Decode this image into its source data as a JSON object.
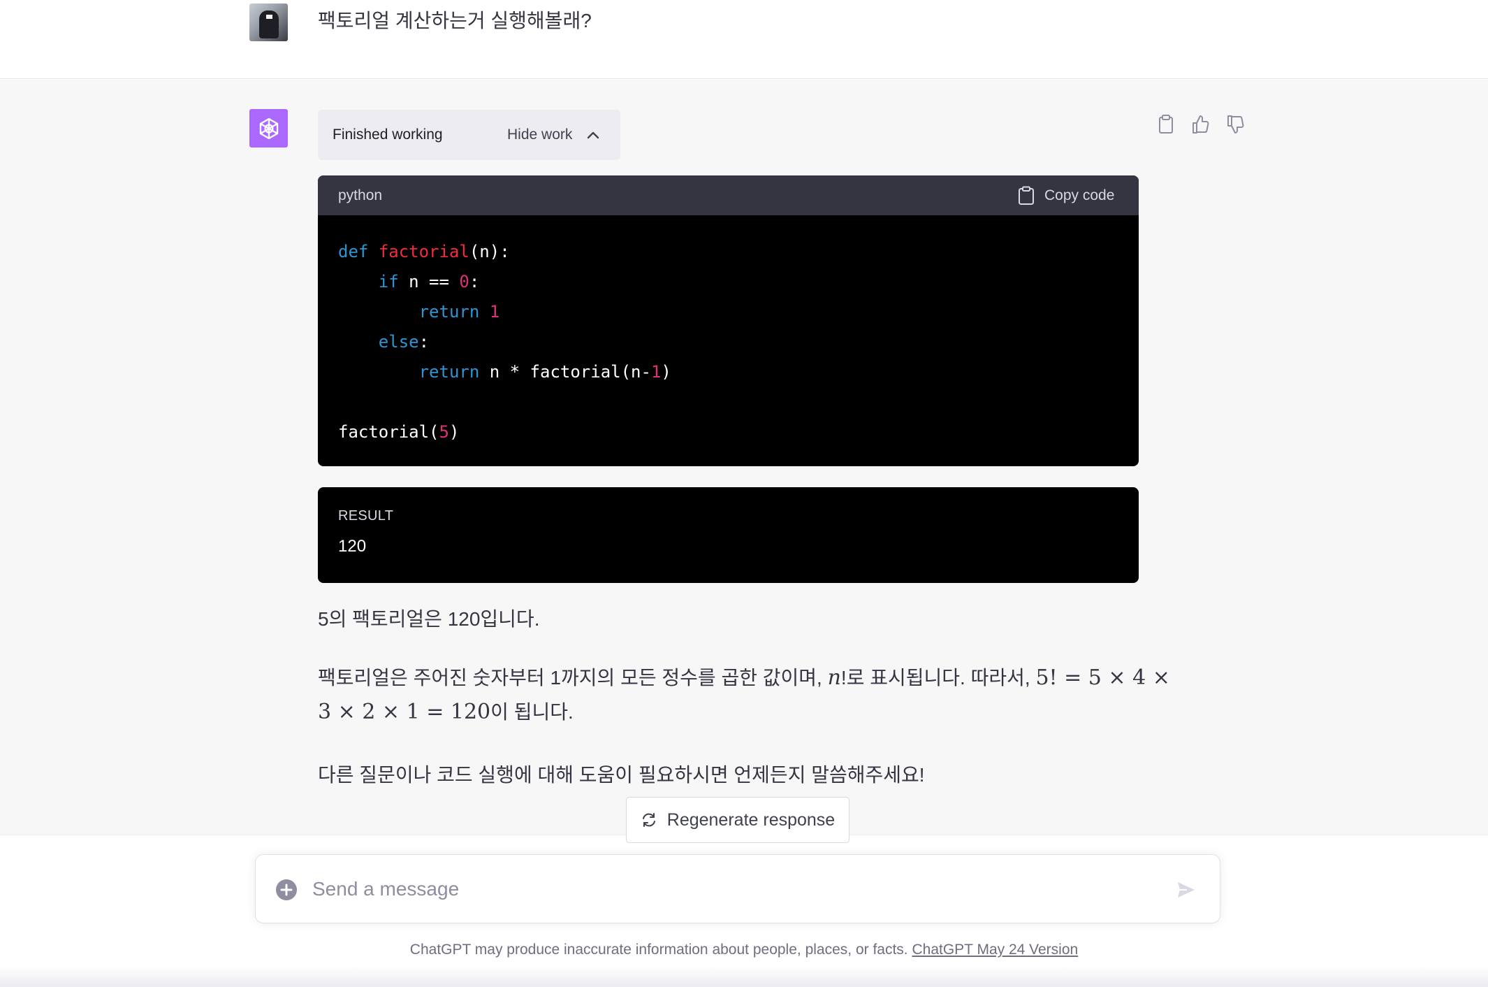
{
  "user_message": {
    "text": "팩토리얼 계산하는거 실행해볼래?"
  },
  "assistant": {
    "work_status": "Finished working",
    "hide_work_label": "Hide work",
    "code_block": {
      "language": "python",
      "copy_label": "Copy code",
      "code_lines": [
        "def factorial(n):",
        "    if n == 0:",
        "        return 1",
        "    else:",
        "        return n * factorial(n-1)",
        "",
        "factorial(5)"
      ]
    },
    "result": {
      "label": "RESULT",
      "value": "120"
    },
    "paragraphs": {
      "p1": "5의 팩토리얼은 120입니다.",
      "p2_text_a": "팩토리얼은 주어진 숫자부터 1까지의 모든 정수를 곱한 값이며, ",
      "p2_math_n": "n",
      "p2_text_b": "!로 표시됩니다. 따라서, ",
      "p2_math_eq1": "5! = 5 × 4 ×",
      "p2_math_eq2": "3 × 2 × 1 = 120",
      "p2_text_c": "이 됩니다.",
      "p3": "다른 질문이나 코드 실행에 대해 도움이 필요하시면 언제든지 말씀해주세요!"
    }
  },
  "regenerate_label": "Regenerate response",
  "composer": {
    "placeholder": "Send a message"
  },
  "footer": {
    "disclaimer": "ChatGPT may produce inaccurate information about people, places, or facts. ",
    "version_link": "ChatGPT May 24 Version"
  },
  "colors": {
    "accent_purple": "#ab68ff",
    "code_keyword": "#2e95d3",
    "code_function": "#f22c3d",
    "code_number": "#df3079",
    "assistant_bg": "#f7f7f8"
  },
  "icons": [
    "user-avatar",
    "chatgpt-logo-icon",
    "chevron-up-icon",
    "clipboard-icon",
    "thumbs-up-icon",
    "thumbs-down-icon",
    "refresh-icon",
    "plus-circle-icon",
    "send-icon"
  ]
}
